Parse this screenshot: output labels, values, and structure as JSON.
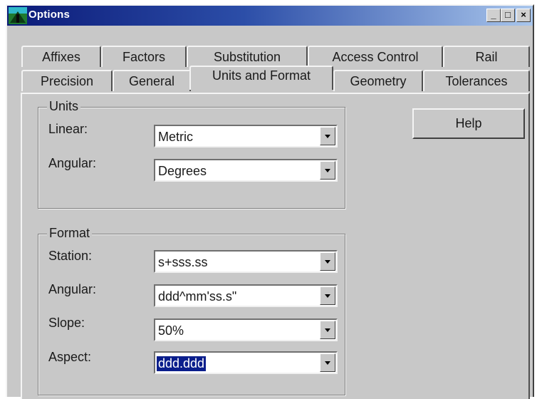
{
  "window": {
    "title": "Options",
    "controls": {
      "minimize": "_",
      "maximize": "□",
      "close": "×"
    }
  },
  "tabs": {
    "row1": [
      "Affixes",
      "Factors",
      "Substitution",
      "Access Control",
      "Rail"
    ],
    "row2": [
      "Precision",
      "General",
      "Units and Format",
      "Geometry",
      "Tolerances"
    ],
    "active": "Units and Format"
  },
  "units_group": {
    "legend": "Units",
    "linear_label": "Linear:",
    "linear_value": "Metric",
    "angular_label": "Angular:",
    "angular_value": "Degrees"
  },
  "format_group": {
    "legend": "Format",
    "station_label": "Station:",
    "station_value": "s+sss.ss",
    "angular_label": "Angular:",
    "angular_value": "ddd^mm'ss.s\"",
    "slope_label": "Slope:",
    "slope_value": "50%",
    "aspect_label": "Aspect:",
    "aspect_value": "ddd.ddd"
  },
  "help_button": "Help",
  "colors": {
    "titlebar_start": "#0b1a78",
    "titlebar_end": "#a9c6ec",
    "face": "#c8c8c8",
    "selection": "#0a1e8c"
  }
}
